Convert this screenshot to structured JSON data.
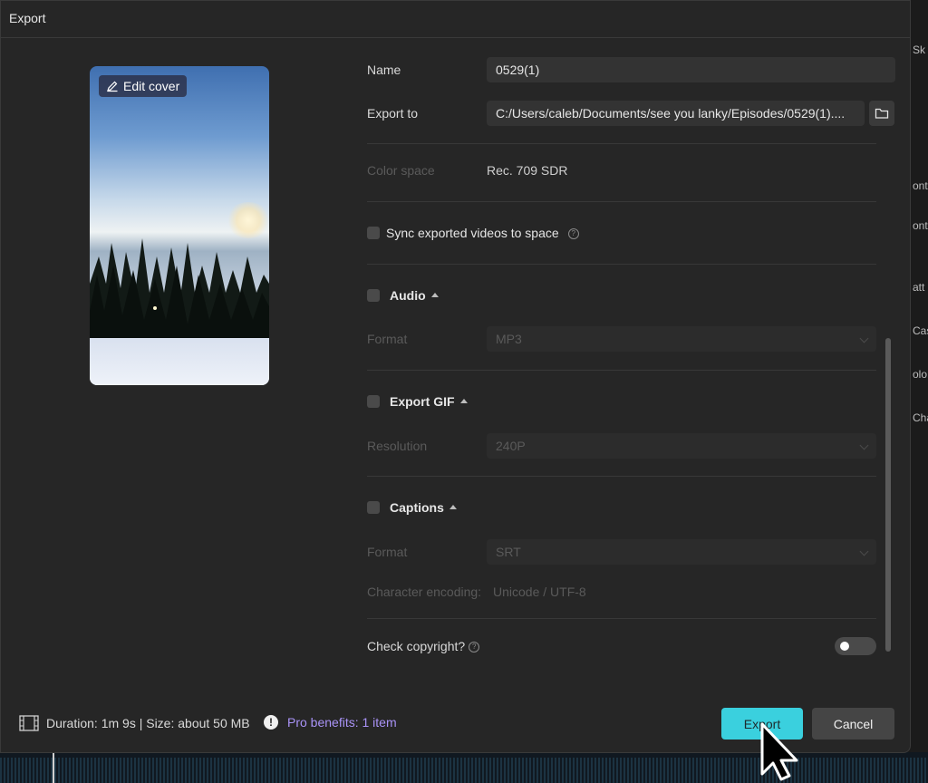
{
  "dialog": {
    "title": "Export",
    "cover_button": "Edit cover"
  },
  "form": {
    "name_label": "Name",
    "name_value": "0529(1)",
    "export_to_label": "Export to",
    "export_to_value": "C:/Users/caleb/Documents/see you lanky/Episodes/0529(1)....",
    "color_space_label": "Color space",
    "color_space_value": "Rec. 709 SDR",
    "sync_label": "Sync exported videos to space",
    "audio": {
      "label": "Audio",
      "format_label": "Format",
      "format_value": "MP3"
    },
    "gif": {
      "label": "Export GIF",
      "resolution_label": "Resolution",
      "resolution_value": "240P"
    },
    "captions": {
      "label": "Captions",
      "format_label": "Format",
      "format_value": "SRT",
      "encoding_label": "Character encoding:",
      "encoding_value": "Unicode / UTF-8"
    },
    "copyright_label": "Check copyright?",
    "copyright_enabled": false
  },
  "footer": {
    "info": "Duration: 1m 9s | Size: about 50 MB",
    "pro": "Pro benefits: 1 item",
    "export_button": "Export",
    "cancel_button": "Cancel"
  },
  "background_app": {
    "labels": [
      "Sk",
      "onti",
      "ont",
      "att",
      "Cas",
      "olo",
      "Cha"
    ]
  },
  "colors": {
    "dialog_bg": "#262626",
    "accent": "#3ad0de",
    "pro_text": "#a993f7"
  }
}
